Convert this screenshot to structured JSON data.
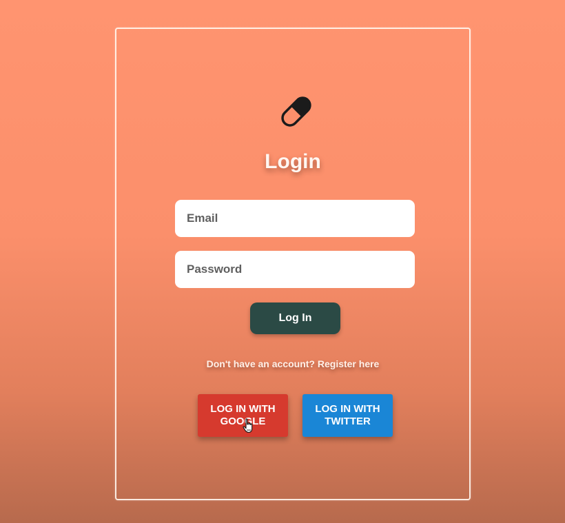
{
  "login_form": {
    "title": "Login",
    "logo_icon": "pill-icon",
    "email": {
      "placeholder": "Email",
      "value": ""
    },
    "password": {
      "placeholder": "Password",
      "value": ""
    },
    "login_button": "Log In",
    "register_prompt": "Don't have an account? Register here",
    "social": {
      "google_label": "LOG IN WITH\nGOOGLE",
      "twitter_label": "LOG IN WITH\nTWITTER"
    }
  },
  "colors": {
    "background": "#fb8f6b",
    "login_button": "#2b4a45",
    "google": "#d63a2e",
    "twitter": "#1a86d6"
  },
  "cursor_icon": "hand-pointer-icon"
}
